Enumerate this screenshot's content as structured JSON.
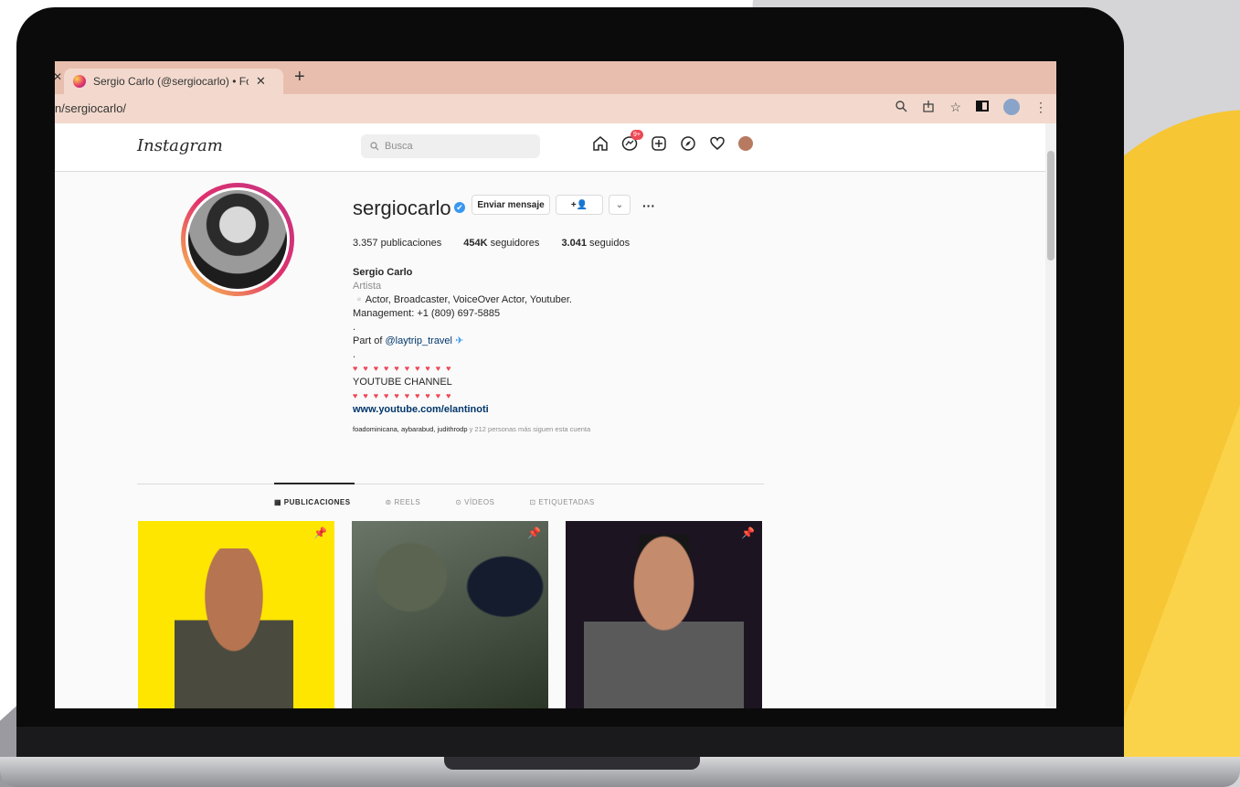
{
  "browser": {
    "tab_title": "Sergio Carlo (@sergiocarlo) • Fot",
    "tab_close": "✕",
    "new_tab": "+",
    "left_close": "✕",
    "url": "n/sergiocarlo/"
  },
  "instagram": {
    "logo": "Instagram",
    "search_placeholder": "Busca",
    "notification_count": "9+"
  },
  "profile": {
    "username": "sergiocarlo",
    "verified_mark": "✔",
    "message_button": "Enviar mensaje",
    "follow_icon": "+👤",
    "dropdown": "⌄",
    "more": "···",
    "stats": {
      "posts": "3.357",
      "posts_label": "publicaciones",
      "followers": "454K",
      "followers_label": "seguidores",
      "following": "3.041",
      "following_label": "seguidos"
    },
    "full_name": "Sergio Carlo",
    "category": "Artista",
    "bio_line1": "▫️Actor, Broadcaster, VoiceOver Actor, Youtuber.",
    "bio_line2": "Management: +1 (809) 697-5885",
    "dot1": ".",
    "part_of_prefix": "Part of ",
    "part_of_mention": "@laytrip_travel",
    "part_of_emoji": "✈",
    "dot2": ".",
    "hearts": "♥♥♥♥♥♥♥♥♥♥",
    "youtube_label": "YOUTUBE CHANNEL",
    "hearts2": "♥♥♥♥♥♥♥♥♥♥",
    "website": "www.youtube.com/elantinoti",
    "followed_names": "foadominicana, aybarabud, judithrodp",
    "followed_suffix": " y 212 personas más siguen esta cuenta"
  },
  "tabs": [
    {
      "label": "PUBLICACIONES",
      "icon": "▦"
    },
    {
      "label": "REELS",
      "icon": "⊚"
    },
    {
      "label": "VÍDEOS",
      "icon": "⊙"
    },
    {
      "label": "ETIQUETADAS",
      "icon": "⊡"
    }
  ],
  "posts": [
    {
      "pin": "📌"
    },
    {
      "pin": "📌"
    },
    {
      "pin": "📌"
    }
  ],
  "colors": {
    "accent": "#e1306c",
    "backdrop_yellow": "#f6c634",
    "tab_bar": "#e8bfae"
  }
}
